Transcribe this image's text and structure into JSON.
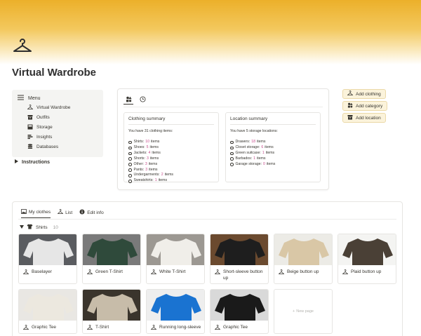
{
  "page": {
    "title": "Virtual Wardrobe",
    "icon": "hanger-icon"
  },
  "menu": {
    "title": "Menu",
    "items": [
      {
        "label": "Virtual Wardrobe",
        "icon": "hanger-icon"
      },
      {
        "label": "Outfits",
        "icon": "archive-icon"
      },
      {
        "label": "Storage",
        "icon": "box-icon"
      },
      {
        "label": "Insights",
        "icon": "chart-icon"
      },
      {
        "label": "Databases",
        "icon": "database-icon"
      }
    ],
    "instructions": "Instructions"
  },
  "summary": {
    "clothing": {
      "title": "Clothing summary",
      "intro": "You have 31 clothing items:",
      "rows": [
        {
          "label": "Shirts:",
          "count": "10",
          "unit": "items"
        },
        {
          "label": "Shoes:",
          "count": "5",
          "unit": "items"
        },
        {
          "label": "Jackets:",
          "count": "4",
          "unit": "items"
        },
        {
          "label": "Shorts:",
          "count": "3",
          "unit": "items"
        },
        {
          "label": "Other:",
          "count": "3",
          "unit": "items"
        },
        {
          "label": "Pants:",
          "count": "3",
          "unit": "items"
        },
        {
          "label": "Undergarments:",
          "count": "2",
          "unit": "items"
        },
        {
          "label": "Sweatshirts:",
          "count": "1",
          "unit": "items"
        }
      ]
    },
    "location": {
      "title": "Location summary",
      "intro": "You have 5 storage locations:",
      "rows": [
        {
          "label": "Drawers:",
          "count": "18",
          "unit": "items"
        },
        {
          "label": "Closet storage:",
          "count": "6",
          "unit": "items"
        },
        {
          "label": "Green suitcase:",
          "count": "1",
          "unit": "items"
        },
        {
          "label": "Barbados:",
          "count": "1",
          "unit": "items"
        },
        {
          "label": "Garage storage:",
          "count": "0",
          "unit": "items"
        }
      ]
    }
  },
  "actions": [
    {
      "label": "Add clothing",
      "icon": "hanger-icon"
    },
    {
      "label": "Add category",
      "icon": "shapes-icon"
    },
    {
      "label": "Add location",
      "icon": "archive-icon"
    }
  ],
  "gallery": {
    "tabs": [
      {
        "label": "My clothes",
        "icon": "gallery-icon",
        "active": true
      },
      {
        "label": "List",
        "icon": "hanger-icon",
        "active": false
      },
      {
        "label": "Edit info",
        "icon": "info-icon",
        "active": false
      }
    ],
    "group": {
      "label": "Shirts",
      "count": "10"
    },
    "items": [
      {
        "name": "Baselayer",
        "bg": "#5a5c60",
        "shirt": "#e6e6e6"
      },
      {
        "name": "Green T-Shirt",
        "bg": "#7a7a7a",
        "shirt": "#2f4a3b"
      },
      {
        "name": "White T-Shirt",
        "bg": "#9c9892",
        "shirt": "#f0eee9"
      },
      {
        "name": "Short-sleeve button up",
        "bg": "#6b4a2f",
        "shirt": "#1e1e1e"
      },
      {
        "name": "Beige button up",
        "bg": "#ecebe6",
        "shirt": "#d9c7a6"
      },
      {
        "name": "Plaid button up",
        "bg": "#f4f4f2",
        "shirt": "#4a4036"
      },
      {
        "name": "Graphic Tee",
        "bg": "#e9e7e3",
        "shirt": "#ece8df"
      },
      {
        "name": "T-Shirt",
        "bg": "#3a342c",
        "shirt": "#c7bca9"
      },
      {
        "name": "Running long-sleeve",
        "bg": "#eeeeee",
        "shirt": "#1a73d1"
      },
      {
        "name": "Graphic Tee",
        "bg": "#d9d9d9",
        "shirt": "#1a1a1a"
      }
    ],
    "new_page": "New page"
  },
  "colors": {
    "accent": "#ecb02a",
    "count": "#c74a8a",
    "button_bg": "#fbf3db"
  }
}
